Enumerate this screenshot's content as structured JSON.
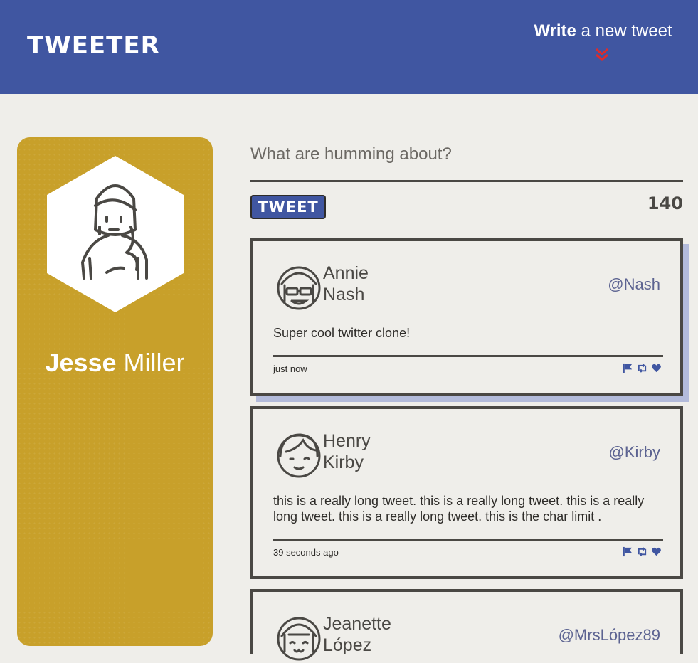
{
  "header": {
    "brand": "TWEETER",
    "compose_strong": "Write",
    "compose_rest": " a new tweet",
    "chevron_icon": "double-chevron-down-icon",
    "chevron_color": "#e02b2b"
  },
  "profile": {
    "first_name": "Jesse",
    "last_name": " Miller",
    "avatar_icon": "girl-avatar-icon"
  },
  "compose": {
    "placeholder": "What are humming about?",
    "button_label": "TWEET",
    "counter": "140"
  },
  "tweets": [
    {
      "first": "Annie",
      "last": "Nash",
      "handle": "@Nash",
      "content": "Super cool twitter clone!",
      "time": "just now",
      "avatar_icon": "sunglasses-avatar-icon"
    },
    {
      "first": "Henry",
      "last": "Kirby",
      "handle": "@Kirby",
      "content": "this is a really long tweet. this is a really long tweet. this is a really long tweet. this is a really long tweet. this is the char limit .",
      "time": "39 seconds ago",
      "avatar_icon": "boy-avatar-icon"
    },
    {
      "first": "Jeanette",
      "last": "López",
      "handle": "@MrsLópez89",
      "avatar_icon": "smiling-girl-avatar-icon"
    }
  ],
  "actions": [
    "flag-icon",
    "retweet-icon",
    "heart-icon"
  ],
  "colors": {
    "nav": "#4056a1",
    "profile_card": "#c8a02a",
    "background": "#efeeea",
    "accent_action": "#4056a1"
  }
}
